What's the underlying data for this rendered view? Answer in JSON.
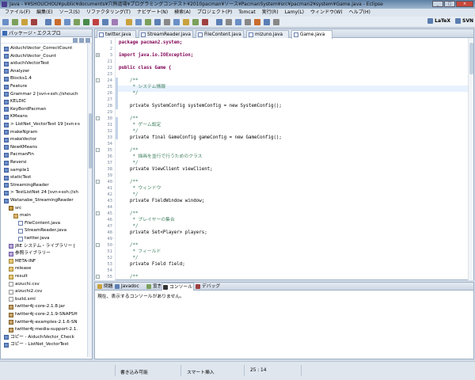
{
  "window": {
    "title": "Java - ¥¥SHOUCHOU¥public¥documents¥穴熊道場¥プログラミングコンテスト¥2010pacman¥ソース¥PacmanSystem¥src¥pacman2¥system¥Game.java - Eclipse"
  },
  "menu": [
    "ファイル(F)",
    "編集(E)",
    "ソース(S)",
    "リファクタリング(T)",
    "ナビゲート(N)",
    "検索(A)",
    "プロジェクト(P)",
    "Tomcat",
    "実行(R)",
    "Lamy(L)",
    "ウィンドウ(W)",
    "ヘルプ(H)"
  ],
  "perspectives": [
    "LaTeX",
    "SVN"
  ],
  "explorer": {
    "title": "パッケージ・エクスプロ",
    "items": [
      {
        "label": "AiduchiVector_CorrectCount",
        "type": "proj",
        "indent": 0
      },
      {
        "label": "AiduchiVector_Count",
        "type": "proj",
        "indent": 0
      },
      {
        "label": "aiduchiVectorTest",
        "type": "proj",
        "indent": 0
      },
      {
        "label": "Analyzer",
        "type": "proj",
        "indent": 0
      },
      {
        "label": "Blocks1.4",
        "type": "proj",
        "indent": 0
      },
      {
        "label": "Feature",
        "type": "proj",
        "indent": 0
      },
      {
        "label": "Grammar 2 [svn+ssh://shouch",
        "type": "proj",
        "indent": 0
      },
      {
        "label": "KELDIC",
        "type": "proj",
        "indent": 0
      },
      {
        "label": "KeyBordPacman",
        "type": "proj",
        "indent": 0
      },
      {
        "label": "KMeans",
        "type": "proj",
        "indent": 0
      },
      {
        "label": "> ListNet_VectorTest 19 [svn+s",
        "type": "proj",
        "indent": 0
      },
      {
        "label": "makeNgram",
        "type": "proj",
        "indent": 0
      },
      {
        "label": "makeVector",
        "type": "proj",
        "indent": 0
      },
      {
        "label": "NewKMeans",
        "type": "proj",
        "indent": 0
      },
      {
        "label": "PacmanFin",
        "type": "proj",
        "indent": 0
      },
      {
        "label": "Reversi",
        "type": "proj",
        "indent": 0
      },
      {
        "label": "sample1",
        "type": "proj",
        "indent": 0
      },
      {
        "label": "staticTest",
        "type": "proj",
        "indent": 0
      },
      {
        "label": "StreamingReader",
        "type": "proj",
        "indent": 0
      },
      {
        "label": "> TestListNet 24 [svn+ssh://sh",
        "type": "proj",
        "indent": 0
      },
      {
        "label": "Watanabe_StreamingReader",
        "type": "proj",
        "indent": 0
      },
      {
        "label": "src",
        "type": "src",
        "indent": 1
      },
      {
        "label": "main",
        "type": "pkg",
        "indent": 2
      },
      {
        "label": "FileContent.java",
        "type": "java",
        "indent": 3
      },
      {
        "label": "StreamReader.java",
        "type": "java",
        "indent": 3
      },
      {
        "label": "twitter.java",
        "type": "java",
        "indent": 3
      },
      {
        "label": "JRE システム・ライブラリー [",
        "type": "lib",
        "indent": 1
      },
      {
        "label": "参照ライブラリー",
        "type": "lib",
        "indent": 1
      },
      {
        "label": "META-INF",
        "type": "folder",
        "indent": 1
      },
      {
        "label": "release",
        "type": "folder",
        "indent": 1
      },
      {
        "label": "result",
        "type": "folder",
        "indent": 1
      },
      {
        "label": "aizuchi.csv",
        "type": "file",
        "indent": 1
      },
      {
        "label": "aizuchi2.csv",
        "type": "file",
        "indent": 1
      },
      {
        "label": "build.xml",
        "type": "file",
        "indent": 1
      },
      {
        "label": "twitter4j-core-2.1.8.jar",
        "type": "jar",
        "indent": 1
      },
      {
        "label": "twitter4j-core-2.1.9-SNAPSH",
        "type": "jar",
        "indent": 1
      },
      {
        "label": "twitter4j-examples-2.1.6-SN",
        "type": "jar",
        "indent": 1
      },
      {
        "label": "twitter4j-media-support-2.1.",
        "type": "jar",
        "indent": 1
      },
      {
        "label": "コピー - AiduchiVector_Check",
        "type": "proj",
        "indent": 0
      },
      {
        "label": "コピー - ListNet_VectorTest",
        "type": "proj",
        "indent": 0
      }
    ]
  },
  "editor": {
    "tabs": [
      {
        "label": "twitter.java",
        "active": false
      },
      {
        "label": "StreamReader.java",
        "active": false
      },
      {
        "label": "FileContent.java",
        "active": false
      },
      {
        "label": "mizuno.java",
        "active": false
      },
      {
        "label": "Game.java",
        "active": true
      }
    ],
    "lines": [
      {
        "n": "1",
        "t": "package pacman2.system;",
        "c": "kw"
      },
      {
        "n": "2",
        "t": "",
        "c": ""
      },
      {
        "n": "3",
        "t": "import java.io.IOException;",
        "c": "imp",
        "fold": "+"
      },
      {
        "n": "21",
        "t": "",
        "c": ""
      },
      {
        "n": "22",
        "t": "public class Game {",
        "c": "kw"
      },
      {
        "n": "23",
        "t": "",
        "c": ""
      },
      {
        "n": "24",
        "t": "    /**",
        "c": "cm",
        "fold": "-"
      },
      {
        "n": "25",
        "t": "     * システム情報",
        "c": "cm"
      },
      {
        "n": "26",
        "t": "     */",
        "c": "cm"
      },
      {
        "n": "27",
        "t": "",
        "c": ""
      },
      {
        "n": "28",
        "t": "    private SystemConfig systemConfig = new SystemConfig();",
        "c": ""
      },
      {
        "n": "29",
        "t": "",
        "c": ""
      },
      {
        "n": "30",
        "t": "    /**",
        "c": "cm",
        "fold": "-"
      },
      {
        "n": "31",
        "t": "     * ゲーム設定",
        "c": "cm"
      },
      {
        "n": "32",
        "t": "     */",
        "c": "cm"
      },
      {
        "n": "33",
        "t": "    private final GameConfig gameConfig = new GameConfig();",
        "c": ""
      },
      {
        "n": "34",
        "t": "",
        "c": ""
      },
      {
        "n": "35",
        "t": "    /**",
        "c": "cm",
        "fold": "-"
      },
      {
        "n": "36",
        "t": "     * 描画を並行で行うためのクラス",
        "c": "cm"
      },
      {
        "n": "37",
        "t": "     */",
        "c": "cm"
      },
      {
        "n": "38",
        "t": "    private ViewClient viewClient;",
        "c": ""
      },
      {
        "n": "39",
        "t": "",
        "c": ""
      },
      {
        "n": "40",
        "t": "    /**",
        "c": "cm",
        "fold": "-"
      },
      {
        "n": "41",
        "t": "     * ウィンドウ",
        "c": "cm"
      },
      {
        "n": "42",
        "t": "     */",
        "c": "cm"
      },
      {
        "n": "43",
        "t": "    private FieldWindow window;",
        "c": ""
      },
      {
        "n": "44",
        "t": "",
        "c": ""
      },
      {
        "n": "45",
        "t": "    /**",
        "c": "cm",
        "fold": "-"
      },
      {
        "n": "46",
        "t": "     * プレイヤーの集合",
        "c": "cm"
      },
      {
        "n": "47",
        "t": "     */",
        "c": "cm"
      },
      {
        "n": "48",
        "t": "    private Set<Player> players;",
        "c": ""
      },
      {
        "n": "49",
        "t": "",
        "c": ""
      },
      {
        "n": "50",
        "t": "    /**",
        "c": "cm",
        "fold": "-"
      },
      {
        "n": "51",
        "t": "     * フィールド",
        "c": "cm"
      },
      {
        "n": "52",
        "t": "     */",
        "c": "cm"
      },
      {
        "n": "53",
        "t": "    private Field field;",
        "c": ""
      },
      {
        "n": "54",
        "t": "",
        "c": ""
      },
      {
        "n": "55",
        "t": "    /**",
        "c": "cm",
        "fold": "-"
      }
    ]
  },
  "console": {
    "tabs": [
      {
        "label": "問題",
        "active": false
      },
      {
        "label": "Javadoc",
        "active": false
      },
      {
        "label": "宣言",
        "active": false
      },
      {
        "label": "コンソール",
        "active": true
      },
      {
        "label": "デバッグ",
        "active": false
      }
    ],
    "message": "現在、表示するコンソールがありません。"
  },
  "status": {
    "write": "書き込み可能",
    "insert": "スマート挿入",
    "position": "25 : 14"
  },
  "colors": {
    "keyword": "#7f0055",
    "comment": "#3f7f5f",
    "linenumber": "#7a8aa0"
  }
}
